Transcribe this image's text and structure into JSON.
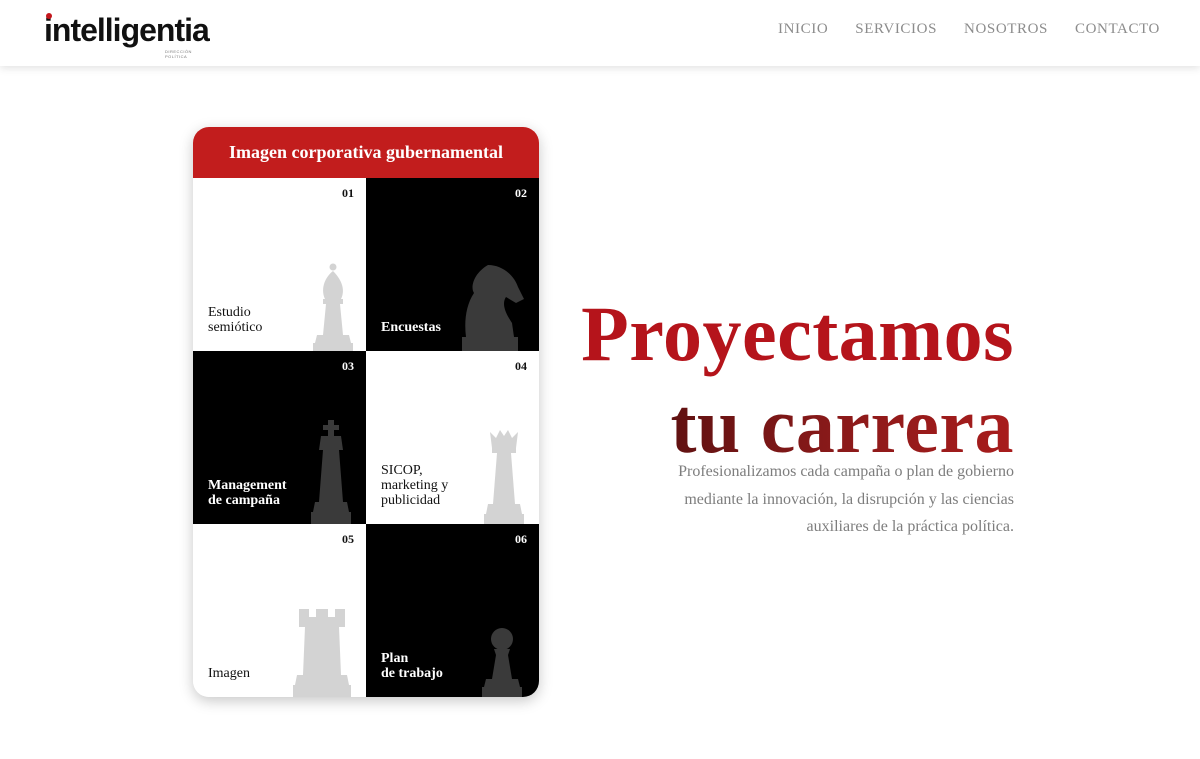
{
  "brand": {
    "name": "intelligentia",
    "tagline": "DIRECCIÓN POLÍTICA",
    "accent_color": "#c21d1d"
  },
  "nav": {
    "items": [
      {
        "label": "INICIO"
      },
      {
        "label": "SERVICIOS"
      },
      {
        "label": "NOSOTROS"
      },
      {
        "label": "CONTACTO"
      }
    ]
  },
  "card": {
    "title": "Imagen corporativa gubernamental",
    "tiles": [
      {
        "number": "01",
        "label": "Estudio\nsemiótico",
        "piece": "bishop-icon",
        "theme": "light"
      },
      {
        "number": "02",
        "label": "Encuestas",
        "piece": "knight-icon",
        "theme": "dark"
      },
      {
        "number": "03",
        "label": "Management\nde campaña",
        "piece": "king-icon",
        "theme": "dark"
      },
      {
        "number": "04",
        "label": "SICOP,\nmarketing y\npublicidad",
        "piece": "queen-icon",
        "theme": "light"
      },
      {
        "number": "05",
        "label": "Imagen",
        "piece": "rook-icon",
        "theme": "light"
      },
      {
        "number": "06",
        "label": "Plan\nde trabajo",
        "piece": "pawn-icon",
        "theme": "dark"
      }
    ]
  },
  "hero": {
    "line1": "Proyectamos",
    "line2": "tu carrera",
    "description": "Profesionalizamos cada campaña o plan de gobierno\nmediante la innovación, la disrupción y las ciencias\nauxiliares de la práctica política."
  }
}
